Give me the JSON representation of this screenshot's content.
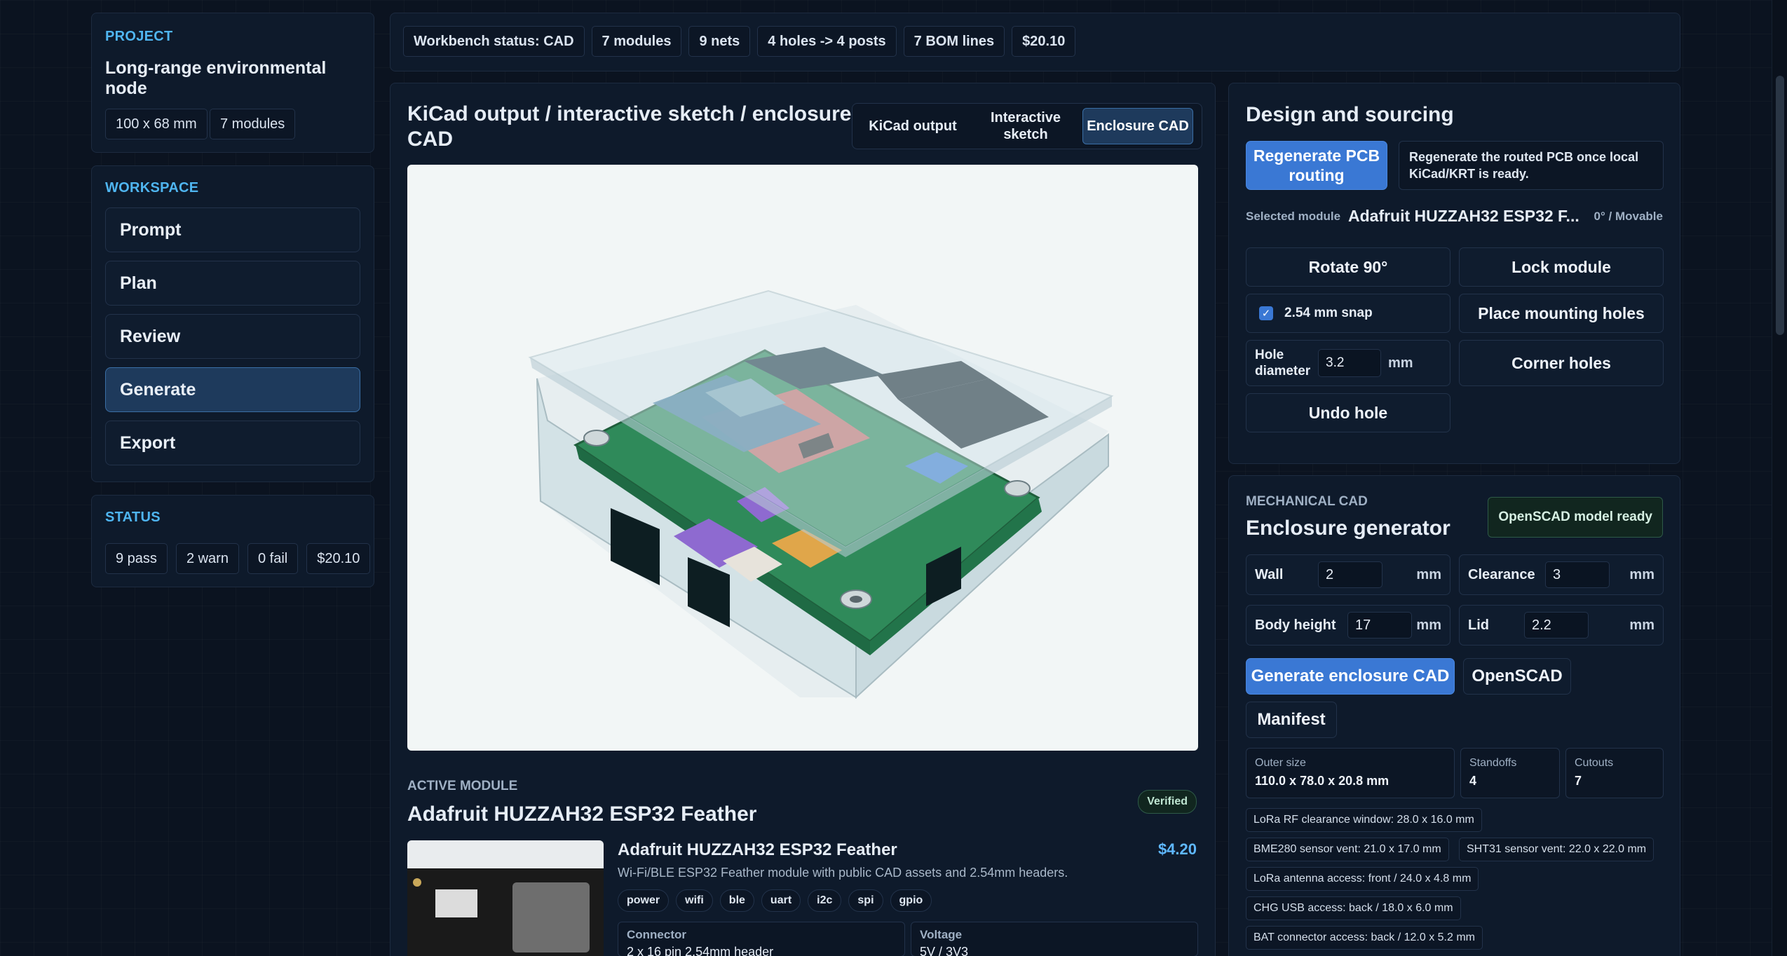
{
  "project": {
    "label": "PROJECT",
    "name": "Long-range environmental node",
    "chips": [
      "100 x 68 mm",
      "7 modules"
    ]
  },
  "workspace": {
    "label": "WORKSPACE",
    "items": [
      "Prompt",
      "Plan",
      "Review",
      "Generate",
      "Export"
    ],
    "active": "Generate"
  },
  "status": {
    "label": "STATUS",
    "chips": [
      "9 pass",
      "2 warn",
      "0 fail",
      "$20.10"
    ]
  },
  "topbar": {
    "chips": [
      "Workbench status: CAD",
      "7 modules",
      "9 nets",
      "4 holes -> 4 posts",
      "7 BOM lines",
      "$20.10"
    ]
  },
  "viewer": {
    "title": "KiCad output / interactive sketch / enclosure CAD",
    "tabs": [
      "KiCad output",
      "Interactive sketch",
      "Enclosure CAD"
    ],
    "active_tab": "Enclosure CAD"
  },
  "active_module": {
    "label": "ACTIVE MODULE",
    "title": "Adafruit HUZZAH32 ESP32 Feather",
    "badge": "Verified",
    "card_title": "Adafruit HUZZAH32 ESP32 Feather",
    "price": "$4.20",
    "description": "Wi-Fi/BLE ESP32 Feather module with public CAD assets and 2.54mm headers.",
    "tags": [
      "power",
      "wifi",
      "ble",
      "uart",
      "i2c",
      "spi",
      "gpio"
    ],
    "connector_label": "Connector",
    "connector_value": "2 x 16 pin 2.54mm header",
    "voltage_label": "Voltage",
    "voltage_value": "5V / 3V3"
  },
  "design": {
    "title": "Design and sourcing",
    "regen_button": "Regenerate PCB routing",
    "regen_note": "Regenerate the routed PCB once local KiCad/KRT is ready.",
    "selected_label": "Selected module",
    "selected_value": "Adafruit HUZZAH32 ESP32 F...",
    "selected_meta": "0° / Movable",
    "rotate": "Rotate 90°",
    "lock": "Lock module",
    "snap_label": "2.54 mm snap",
    "snap_checked": true,
    "place_holes": "Place mounting holes",
    "hole_label": "Hole diameter",
    "hole_value": "3.2",
    "hole_unit": "mm",
    "corner_holes": "Corner holes",
    "undo_hole": "Undo hole"
  },
  "mechanical": {
    "label": "MECHANICAL CAD",
    "title": "Enclosure generator",
    "ready_badge": "OpenSCAD model ready",
    "fields": {
      "wall_label": "Wall",
      "wall_value": "2",
      "clearance_label": "Clearance",
      "clearance_value": "3",
      "body_label": "Body height",
      "body_value": "17",
      "lid_label": "Lid",
      "lid_value": "2.2",
      "unit": "mm"
    },
    "generate_button": "Generate enclosure CAD",
    "openscad_button": "OpenSCAD",
    "manifest_button": "Manifest",
    "outer_label": "Outer size",
    "outer_value": "110.0 x 78.0 x 20.8 mm",
    "standoffs_label": "Standoffs",
    "standoffs_value": "4",
    "cutouts_label": "Cutouts",
    "cutouts_value": "7",
    "notes": [
      "LoRa RF clearance window: 28.0 x 16.0 mm",
      "BME280 sensor vent: 21.0 x 17.0 mm",
      "SHT31 sensor vent: 22.0 x 22.0 mm",
      "LoRa antenna access: front / 24.0 x 4.8 mm",
      "CHG USB access: back / 18.0 x 6.0 mm",
      "BAT connector access: back / 12.0 x 5.2 mm"
    ]
  },
  "colors": {
    "accent": "#4fb5f0",
    "primary_button": "#3a78d4",
    "panel": "#0e1a2b",
    "background": "#0b1320",
    "pcb_green": "#2f8a5a",
    "verified": "#1d3b34"
  }
}
